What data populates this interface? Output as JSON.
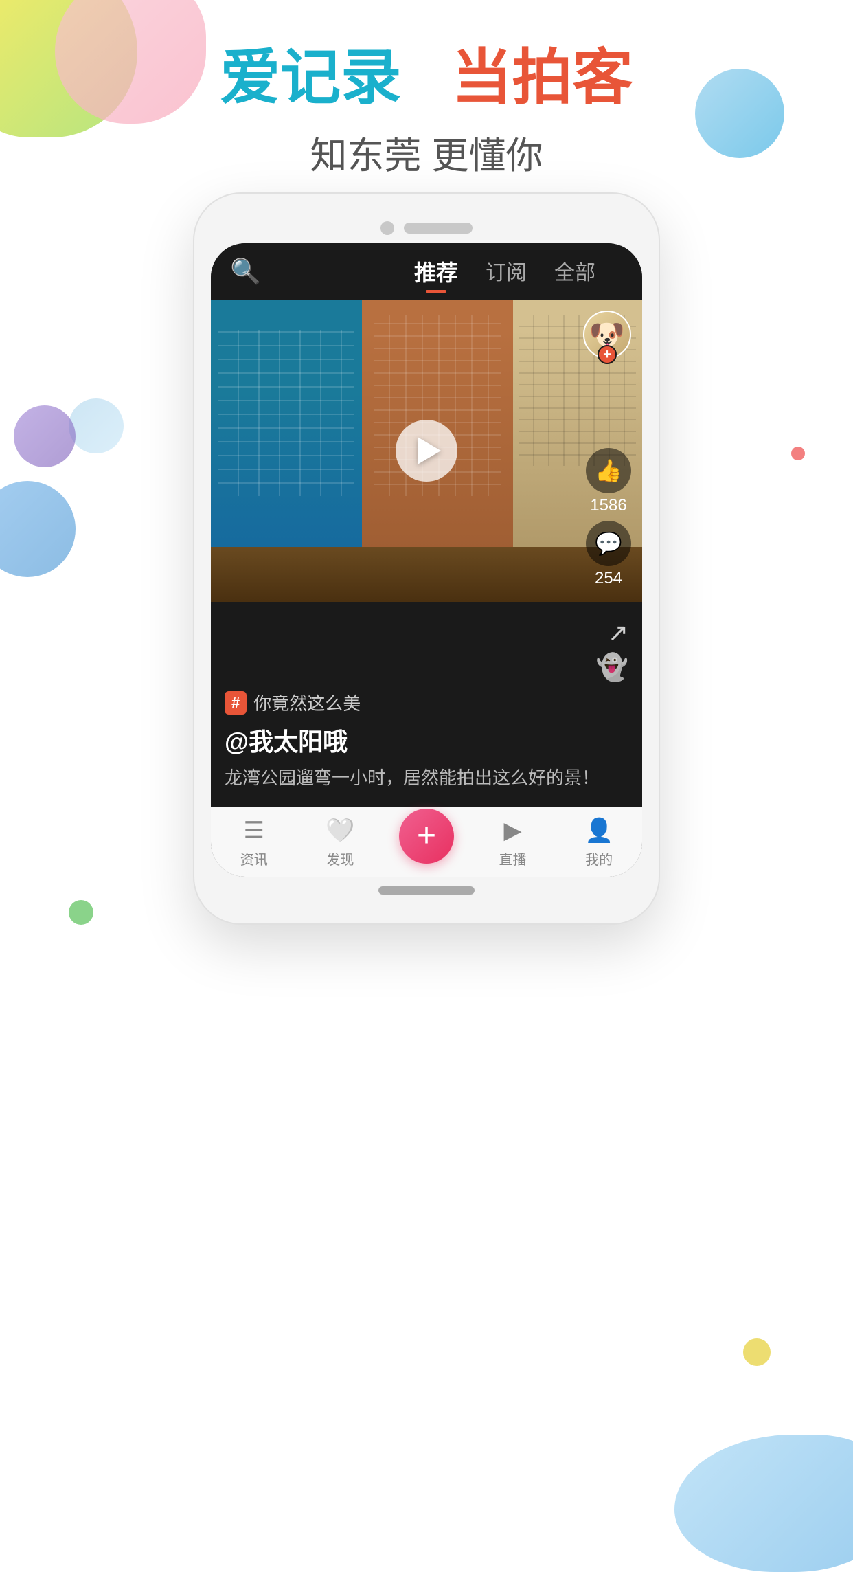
{
  "background": {
    "color": "#ffffff"
  },
  "header": {
    "line1_blue": "爱记录",
    "line1_red": "当拍客",
    "subtitle": "知东莞  更懂你"
  },
  "app": {
    "navbar": {
      "search_placeholder": "搜索",
      "tabs": [
        {
          "id": "recommended",
          "label": "推荐",
          "active": true
        },
        {
          "id": "subscribed",
          "label": "订阅",
          "active": false
        },
        {
          "id": "all",
          "label": "全部",
          "active": false
        }
      ]
    },
    "video": {
      "avatar_emoji": "🐶",
      "likes_count": "1586",
      "comments_count": "254"
    },
    "content": {
      "tag_label": "#",
      "tag_text": "你竟然这么美",
      "author": "@我太阳哦",
      "description": "龙湾公园遛弯一小时，居然能拍出这么好的景！"
    },
    "bottom_tabs": [
      {
        "id": "news",
        "label": "资讯",
        "icon": "📰"
      },
      {
        "id": "discover",
        "label": "发现",
        "icon": "❤"
      },
      {
        "id": "add",
        "label": "+",
        "icon": "+"
      },
      {
        "id": "live",
        "label": "直播",
        "icon": "▶"
      },
      {
        "id": "mine",
        "label": "我的",
        "icon": "👤"
      }
    ]
  }
}
